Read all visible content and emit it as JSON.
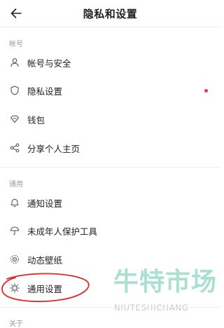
{
  "header": {
    "title": "隐私和设置",
    "back_icon": "arrow-left-icon"
  },
  "sections": [
    {
      "label": "帐号",
      "items": [
        {
          "label": "帐号与安全",
          "icon": "person-icon"
        },
        {
          "label": "隐私设置",
          "icon": "shield-icon",
          "badge": true
        },
        {
          "label": "钱包",
          "icon": "wallet-icon"
        },
        {
          "label": "分享个人主页",
          "icon": "share-icon"
        }
      ]
    },
    {
      "label": "通用",
      "items": [
        {
          "label": "通知设置",
          "icon": "bell-icon"
        },
        {
          "label": "未成年人保护工具",
          "icon": "umbrella-icon"
        },
        {
          "label": "动态壁纸",
          "icon": "wallpaper-icon"
        },
        {
          "label": "通用设置",
          "icon": "gear-icon"
        }
      ]
    }
  ],
  "next_section_label": "关于",
  "colors": {
    "badge": "#f0344d",
    "annotation": "#e02a2a",
    "watermark": "#a9e0cf"
  },
  "watermark": {
    "cn": "牛特市场",
    "en": "NIUTESHICHANG"
  }
}
